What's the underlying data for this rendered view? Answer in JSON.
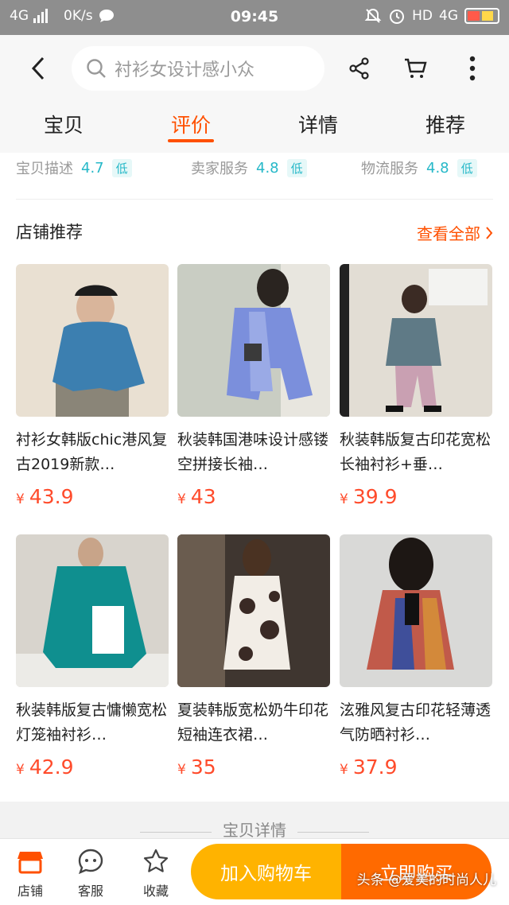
{
  "status_bar": {
    "network": "4G",
    "speed": "0K/s",
    "time": "09:45",
    "hd_label": "HD",
    "network_right": "4G"
  },
  "search": {
    "placeholder": "衬衫女设计感小众"
  },
  "tabs": [
    {
      "label": "宝贝",
      "active": false
    },
    {
      "label": "评价",
      "active": true
    },
    {
      "label": "详情",
      "active": false
    },
    {
      "label": "推荐",
      "active": false
    }
  ],
  "ratings": [
    {
      "label": "宝贝描述",
      "score": "4.7",
      "level": "低"
    },
    {
      "label": "卖家服务",
      "score": "4.8",
      "level": "低"
    },
    {
      "label": "物流服务",
      "score": "4.8",
      "level": "低"
    }
  ],
  "shop": {
    "title": "店铺推荐",
    "see_all": "查看全部"
  },
  "products": [
    {
      "title": "衬衫女韩版chic港风复古2019新款…",
      "currency": "¥",
      "price": "43.9"
    },
    {
      "title": "秋装韩国港味设计感镂空拼接长袖…",
      "currency": "¥",
      "price": "43"
    },
    {
      "title": "秋装韩版复古印花宽松长袖衬衫+垂…",
      "currency": "¥",
      "price": "39.9"
    },
    {
      "title": "秋装韩版复古慵懒宽松灯笼袖衬衫…",
      "currency": "¥",
      "price": "42.9"
    },
    {
      "title": "夏装韩版宽松奶牛印花短袖连衣裙…",
      "currency": "¥",
      "price": "35"
    },
    {
      "title": "泫雅风复古印花轻薄透气防晒衬衫…",
      "currency": "¥",
      "price": "37.9"
    }
  ],
  "detail_section": {
    "label": "宝贝详情"
  },
  "bottom_bar": {
    "shop_label": "店铺",
    "service_label": "客服",
    "favorite_label": "收藏",
    "add_cart_label": "加入购物车",
    "buy_now_label": "立即购买"
  },
  "watermark": "头条 @爱美的时尚人儿",
  "colors": {
    "accent": "#ff5000",
    "price": "#ff4b2b",
    "rating": "#26b8c8",
    "cart_button": "#ffb300",
    "buy_button": "#ff6a00"
  }
}
